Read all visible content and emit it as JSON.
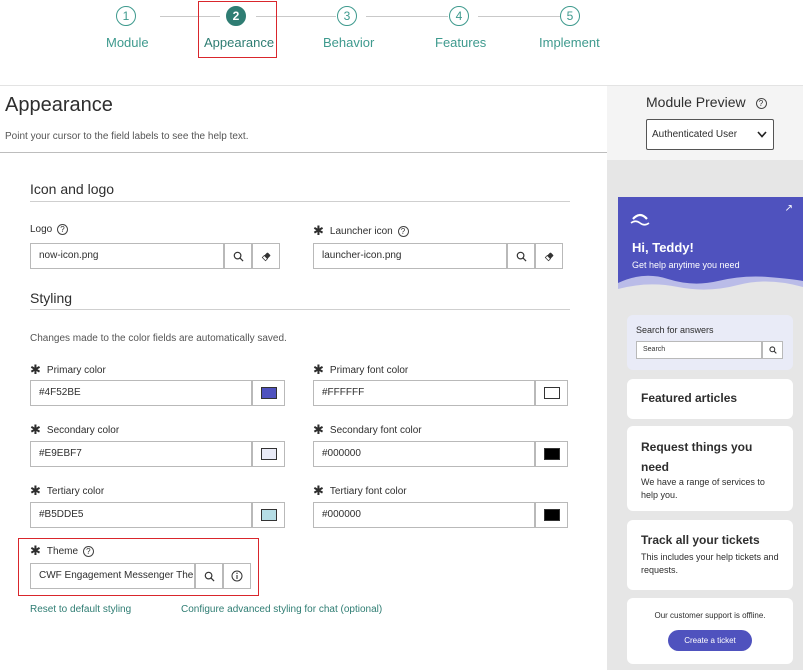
{
  "stepper": {
    "steps": [
      {
        "num": "1",
        "label": "Module"
      },
      {
        "num": "2",
        "label": "Appearance"
      },
      {
        "num": "3",
        "label": "Behavior"
      },
      {
        "num": "4",
        "label": "Features"
      },
      {
        "num": "5",
        "label": "Implement"
      }
    ],
    "active_index": 1
  },
  "page": {
    "title": "Appearance",
    "subtitle": "Point your cursor to the field labels to see the help text."
  },
  "icon_logo": {
    "section_title": "Icon and logo",
    "logo_label": "Logo",
    "logo_value": "now-icon.png",
    "launcher_label": "Launcher icon",
    "launcher_value": "launcher-icon.png"
  },
  "styling": {
    "section_title": "Styling",
    "note": "Changes made to the color fields are automatically saved.",
    "primary_color_label": "Primary color",
    "primary_color_value": "#4F52BE",
    "primary_font_label": "Primary font color",
    "primary_font_value": "#FFFFFF",
    "secondary_color_label": "Secondary color",
    "secondary_color_value": "#E9EBF7",
    "secondary_font_label": "Secondary font color",
    "secondary_font_value": "#000000",
    "tertiary_color_label": "Tertiary color",
    "tertiary_color_value": "#B5DDE5",
    "tertiary_font_label": "Tertiary font color",
    "tertiary_font_value": "#000000",
    "theme_label": "Theme",
    "theme_value": "CWF Engagement Messenger The",
    "reset_link": "Reset to default styling",
    "advanced_link": "Configure advanced styling for chat (optional)"
  },
  "icons": {
    "required": "asterisk-icon",
    "help": "question-circle-icon",
    "search": "search-icon",
    "clear": "eraser-icon",
    "info": "info-icon",
    "chevron": "chevron-down-icon",
    "expand": "arrow-up-right-icon",
    "logo": "wave-logo-icon"
  },
  "preview": {
    "title": "Module Preview",
    "audience_selected": "Authenticated User",
    "greeting": "Hi, Teddy!",
    "greeting_sub": "Get help anytime you need",
    "search_title": "Search for answers",
    "search_placeholder": "Search",
    "featured_title": "Featured articles",
    "request_title": "Request things you need",
    "request_desc": "We have a range of services to help you.",
    "track_title": "Track all your tickets",
    "track_desc": "This includes your help tickets and requests.",
    "offline_text": "Our customer support is offline.",
    "ticket_button": "Create a ticket"
  }
}
